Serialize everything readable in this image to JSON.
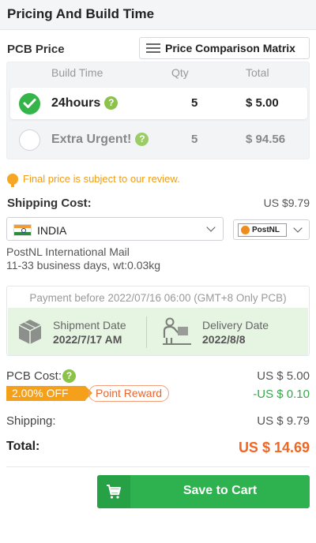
{
  "header": {
    "title": "Pricing And Build Time"
  },
  "pcb_price": {
    "label": "PCB Price",
    "matrix_button": "Price Comparison Matrix",
    "columns": {
      "build_time": "Build Time",
      "qty": "Qty",
      "total": "Total"
    },
    "rows": [
      {
        "build_time": "24hours",
        "qty": "5",
        "total": "$ 5.00",
        "selected": true
      },
      {
        "build_time": "Extra Urgent!",
        "qty": "5",
        "total": "$ 94.56",
        "selected": false
      }
    ]
  },
  "notice": "Final price is subject to our review.",
  "shipping": {
    "label": "Shipping Cost:",
    "value": "US $9.79",
    "country": "INDIA",
    "carrier_logo": "PostNL",
    "service_name": "PostNL International Mail",
    "service_detail": "11-33 business days, wt:0.03kg"
  },
  "timeline": {
    "payment_before": "Payment before 2022/07/16 06:00 (GMT+8 Only PCB)",
    "shipment_label": "Shipment Date",
    "shipment_value": "2022/7/17 AM",
    "delivery_label": "Delivery Date",
    "delivery_value": "2022/8/8"
  },
  "summary": {
    "pcb_cost_label": "PCB Cost:",
    "pcb_cost_value": "US $ 5.00",
    "off_badge": "2.00% OFF",
    "reward_label": "Point Reward",
    "discount_value": "-US $ 0.10",
    "shipping_label": "Shipping:",
    "shipping_value": "US $ 9.79",
    "total_label": "Total:",
    "total_value": "US $ 14.69"
  },
  "cart_button": "Save to Cart",
  "colors": {
    "accent_green": "#2eb24f",
    "orange": "#f26522",
    "badge": "#f5a01a"
  },
  "icons": [
    "list-icon",
    "check-icon",
    "question-icon",
    "bulb-icon",
    "india-flag-icon",
    "postnl-logo",
    "chevron-down-icon",
    "box-icon",
    "delivery-icon",
    "cart-icon"
  ]
}
